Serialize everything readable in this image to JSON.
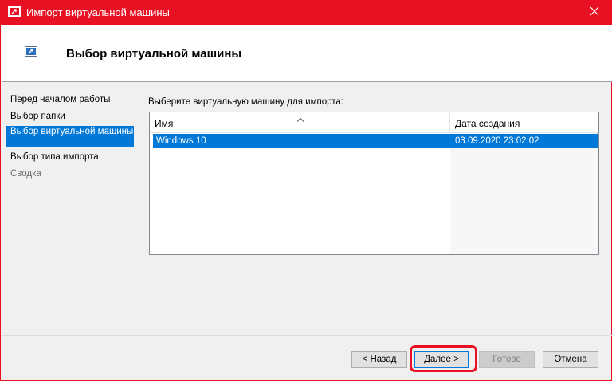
{
  "window": {
    "title": "Импорт виртуальной машины",
    "accent_color": "#e81123",
    "icons": {
      "app": "import-vm-icon",
      "close": "close-icon"
    }
  },
  "header": {
    "title": "Выбор виртуальной машины",
    "icon": "import-vm-icon"
  },
  "sidebar": {
    "items": [
      {
        "label": "Перед началом работы",
        "state": "normal"
      },
      {
        "label": "Выбор папки",
        "state": "normal"
      },
      {
        "label": "Выбор виртуальной машины",
        "state": "active"
      },
      {
        "label": "Выбор типа импорта",
        "state": "normal"
      },
      {
        "label": "Сводка",
        "state": "disabled"
      }
    ],
    "active_color": "#0078d7"
  },
  "main": {
    "prompt": "Выберите виртуальную машину для импорта:",
    "table": {
      "columns": [
        "Имя",
        "Дата создания"
      ],
      "sorted_column": "Имя",
      "rows": [
        {
          "name": "Windows 10",
          "created": "03.09.2020 23:02:02",
          "selected": true
        }
      ]
    }
  },
  "footer": {
    "buttons": {
      "back": "< Назад",
      "next": "Далее >",
      "finish": "Готово",
      "cancel": "Отмена"
    }
  }
}
